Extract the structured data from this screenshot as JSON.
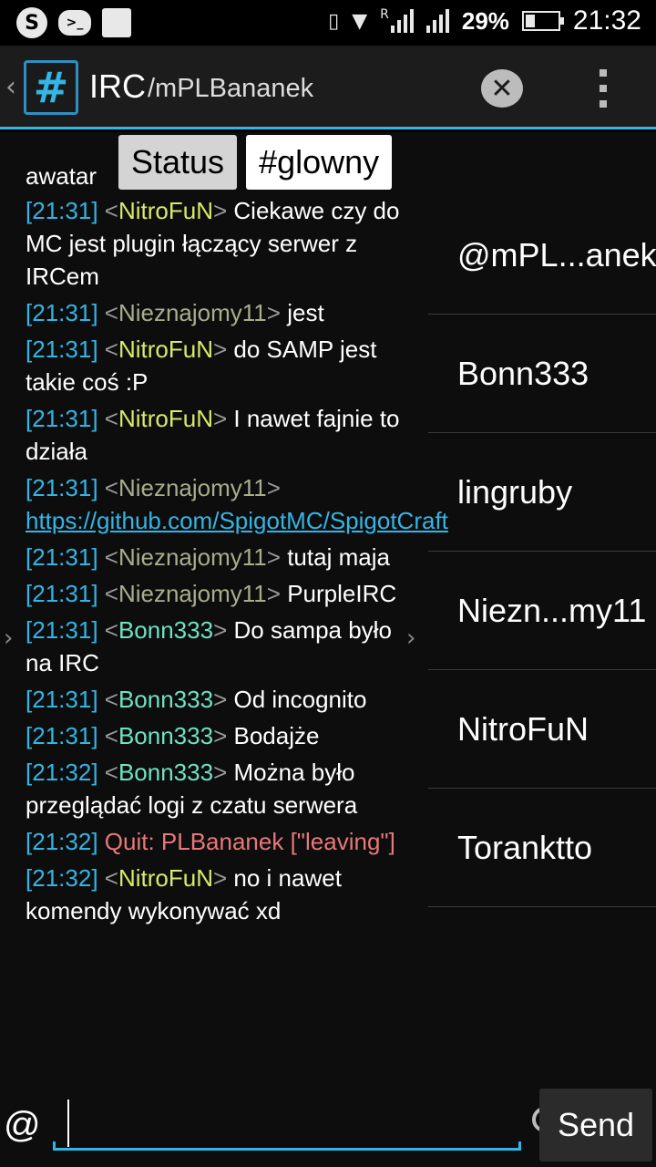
{
  "status_bar": {
    "battery_percent": "29%",
    "battery_level": 0.29,
    "time": "21:32",
    "roaming_mark": "R",
    "icons": [
      "skype-icon",
      "cloud-chat-icon",
      "image-icon",
      "vibrate-icon",
      "wifi-icon",
      "signal-icon",
      "signal-icon",
      "battery-icon"
    ]
  },
  "action_bar": {
    "title": "IRC",
    "subtitle": "/mPLBananek"
  },
  "tabs": [
    {
      "label": "Status",
      "active": false
    },
    {
      "label": "#glowny",
      "active": true
    }
  ],
  "chat": {
    "partial_line": "awatar",
    "messages": [
      {
        "time": "21:31",
        "nick": "NitroFuN",
        "kind": "nitro",
        "text": "Ciekawe czy do MC jest plugin łączący serwer z IRCem"
      },
      {
        "time": "21:31",
        "nick": "Nieznajomy11",
        "kind": "niez",
        "text": "jest"
      },
      {
        "time": "21:31",
        "nick": "NitroFuN",
        "kind": "nitro",
        "text": "do SAMP jest takie coś :P"
      },
      {
        "time": "21:31",
        "nick": "NitroFuN",
        "kind": "nitro",
        "text": "I nawet fajnie to działa"
      },
      {
        "time": "21:31",
        "nick": "Nieznajomy11",
        "kind": "niez",
        "link": "https://github.com/SpigotMC/SpigotCraft"
      },
      {
        "time": "21:31",
        "nick": "Nieznajomy11",
        "kind": "niez",
        "text": "tutaj maja"
      },
      {
        "time": "21:31",
        "nick": "Nieznajomy11",
        "kind": "niez",
        "text": "PurpleIRC"
      },
      {
        "time": "21:31",
        "nick": "Bonn333",
        "kind": "bonn",
        "text": "Do sampa było na IRC"
      },
      {
        "time": "21:31",
        "nick": "Bonn333",
        "kind": "bonn",
        "text": "Od incognito"
      },
      {
        "time": "21:31",
        "nick": "Bonn333",
        "kind": "bonn",
        "text": "Bodajże"
      },
      {
        "time": "21:32",
        "nick": "Bonn333",
        "kind": "bonn",
        "text": "Można było przeglądać logi z czatu serwera"
      },
      {
        "time": "21:32",
        "quit": "Quit: PLBananek [\"leaving\"]"
      },
      {
        "time": "21:32",
        "nick": "NitroFuN",
        "kind": "nitro",
        "text": "no i nawet komendy wykonywać xd"
      }
    ]
  },
  "users": [
    "@mPL...anek",
    "Bonn333",
    "lingruby",
    "Niezn...my11",
    "NitroFuN",
    "Toranktto"
  ],
  "input": {
    "prefix": "@",
    "value": "",
    "send_label": "Send"
  },
  "colors": {
    "accent": "#33b5e5",
    "nick_nitro": "#d8ea6a",
    "nick_nieznajomy": "#a9ad8e",
    "nick_bonn": "#6ee3c2",
    "quit": "#e8787a"
  }
}
